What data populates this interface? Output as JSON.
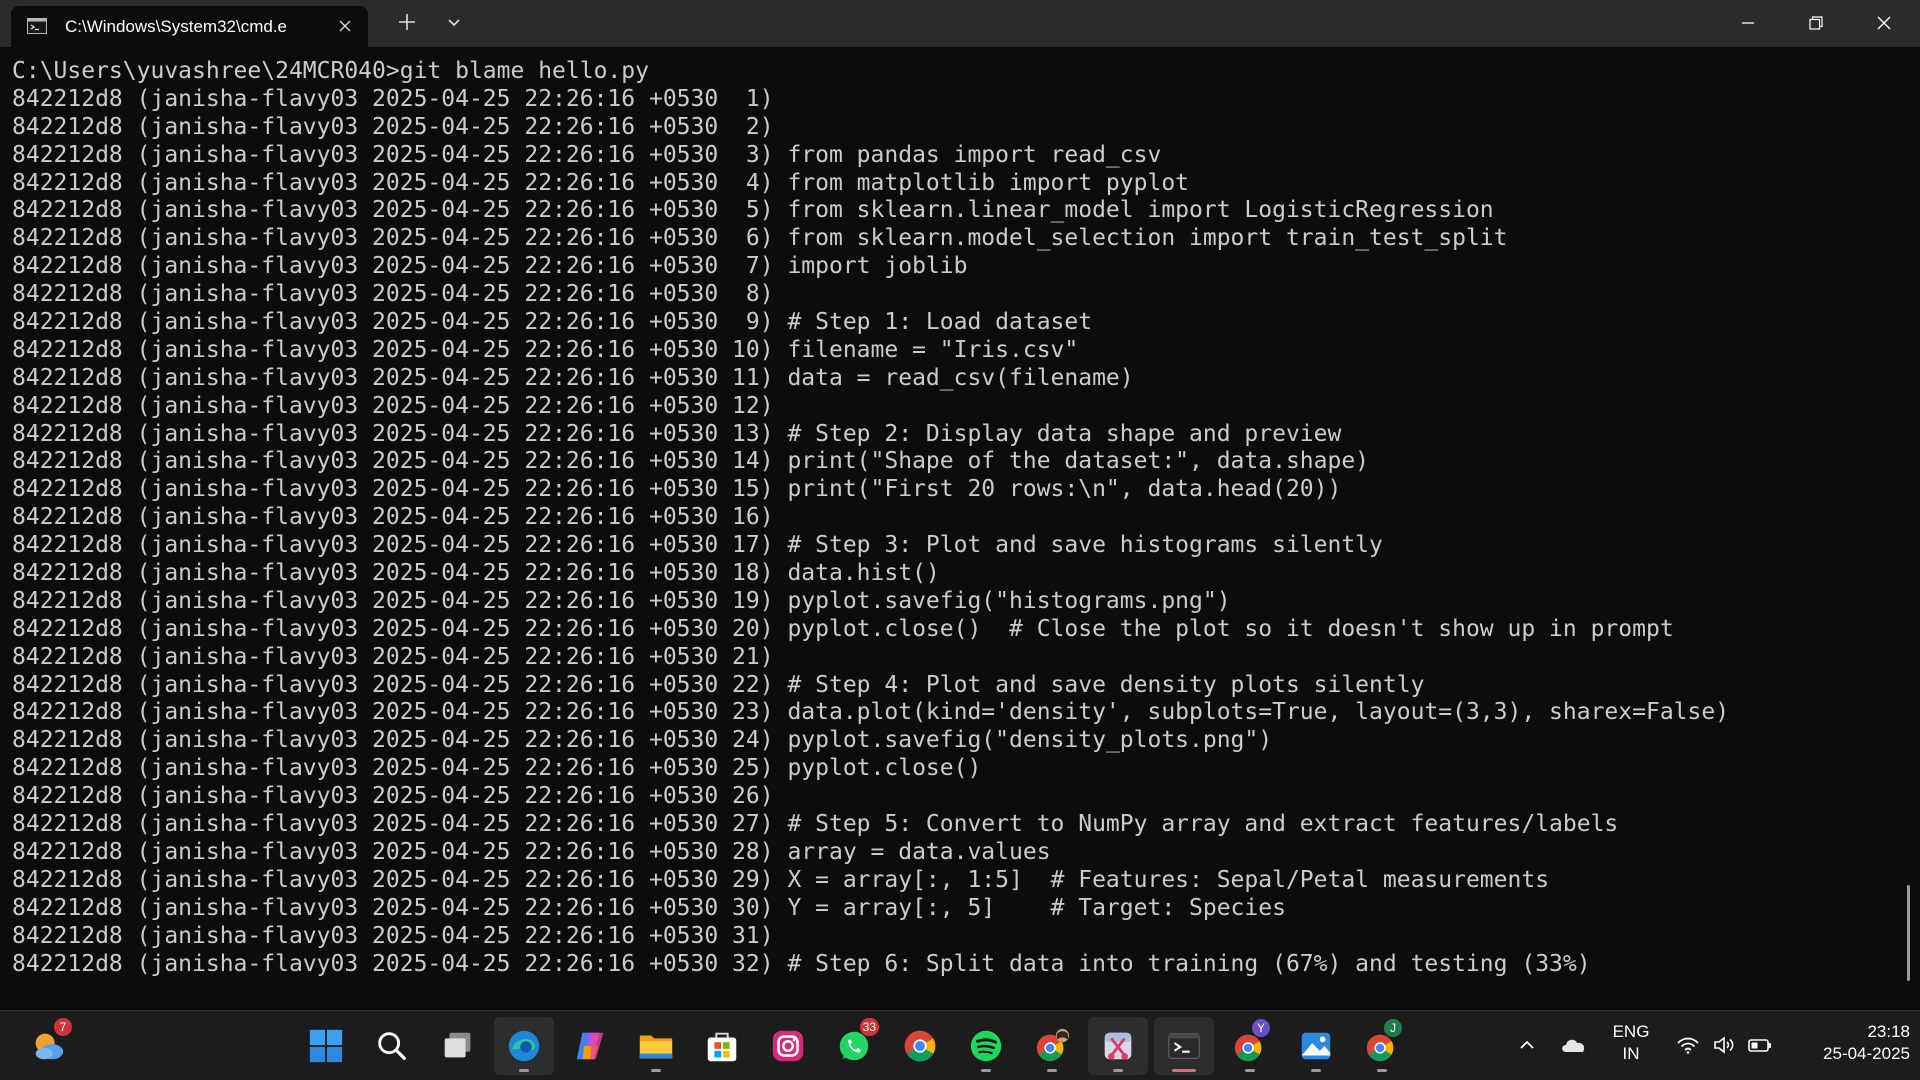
{
  "window": {
    "tab_title": "C:\\Windows\\System32\\cmd.e",
    "tab_icon": "cmd-icon",
    "accent": "#0c0c0c",
    "titlebar_color": "#2b2b2b"
  },
  "terminal": {
    "lines": [
      "C:\\Users\\yuvashree\\24MCR040>git blame hello.py",
      "842212d8 (janisha-flavy03 2025-04-25 22:26:16 +0530  1)",
      "842212d8 (janisha-flavy03 2025-04-25 22:26:16 +0530  2)",
      "842212d8 (janisha-flavy03 2025-04-25 22:26:16 +0530  3) from pandas import read_csv",
      "842212d8 (janisha-flavy03 2025-04-25 22:26:16 +0530  4) from matplotlib import pyplot",
      "842212d8 (janisha-flavy03 2025-04-25 22:26:16 +0530  5) from sklearn.linear_model import LogisticRegression",
      "842212d8 (janisha-flavy03 2025-04-25 22:26:16 +0530  6) from sklearn.model_selection import train_test_split",
      "842212d8 (janisha-flavy03 2025-04-25 22:26:16 +0530  7) import joblib",
      "842212d8 (janisha-flavy03 2025-04-25 22:26:16 +0530  8)",
      "842212d8 (janisha-flavy03 2025-04-25 22:26:16 +0530  9) # Step 1: Load dataset",
      "842212d8 (janisha-flavy03 2025-04-25 22:26:16 +0530 10) filename = \"Iris.csv\"",
      "842212d8 (janisha-flavy03 2025-04-25 22:26:16 +0530 11) data = read_csv(filename)",
      "842212d8 (janisha-flavy03 2025-04-25 22:26:16 +0530 12)",
      "842212d8 (janisha-flavy03 2025-04-25 22:26:16 +0530 13) # Step 2: Display data shape and preview",
      "842212d8 (janisha-flavy03 2025-04-25 22:26:16 +0530 14) print(\"Shape of the dataset:\", data.shape)",
      "842212d8 (janisha-flavy03 2025-04-25 22:26:16 +0530 15) print(\"First 20 rows:\\n\", data.head(20))",
      "842212d8 (janisha-flavy03 2025-04-25 22:26:16 +0530 16)",
      "842212d8 (janisha-flavy03 2025-04-25 22:26:16 +0530 17) # Step 3: Plot and save histograms silently",
      "842212d8 (janisha-flavy03 2025-04-25 22:26:16 +0530 18) data.hist()",
      "842212d8 (janisha-flavy03 2025-04-25 22:26:16 +0530 19) pyplot.savefig(\"histograms.png\")",
      "842212d8 (janisha-flavy03 2025-04-25 22:26:16 +0530 20) pyplot.close()  # Close the plot so it doesn't show up in prompt",
      "842212d8 (janisha-flavy03 2025-04-25 22:26:16 +0530 21)",
      "842212d8 (janisha-flavy03 2025-04-25 22:26:16 +0530 22) # Step 4: Plot and save density plots silently",
      "842212d8 (janisha-flavy03 2025-04-25 22:26:16 +0530 23) data.plot(kind='density', subplots=True, layout=(3,3), sharex=False)",
      "842212d8 (janisha-flavy03 2025-04-25 22:26:16 +0530 24) pyplot.savefig(\"density_plots.png\")",
      "842212d8 (janisha-flavy03 2025-04-25 22:26:16 +0530 25) pyplot.close()",
      "842212d8 (janisha-flavy03 2025-04-25 22:26:16 +0530 26)",
      "842212d8 (janisha-flavy03 2025-04-25 22:26:16 +0530 27) # Step 5: Convert to NumPy array and extract features/labels",
      "842212d8 (janisha-flavy03 2025-04-25 22:26:16 +0530 28) array = data.values",
      "842212d8 (janisha-flavy03 2025-04-25 22:26:16 +0530 29) X = array[:, 1:5]  # Features: Sepal/Petal measurements",
      "842212d8 (janisha-flavy03 2025-04-25 22:26:16 +0530 30) Y = array[:, 5]    # Target: Species",
      "842212d8 (janisha-flavy03 2025-04-25 22:26:16 +0530 31)",
      "842212d8 (janisha-flavy03 2025-04-25 22:26:16 +0530 32) # Step 6: Split data into training (67%) and testing (33%)"
    ],
    "text_color": "#cccccc",
    "background": "#0c0c0c"
  },
  "taskbar": {
    "weather_badge": "7",
    "whatsapp_badge": "33",
    "chrome_profile_y": "Y",
    "chrome_profile_j": "J",
    "apps": [
      "weather-widget-icon",
      "windows-start-icon",
      "search-icon",
      "task-view-icon",
      "edge-icon",
      "copilot-icon",
      "file-explorer-icon",
      "microsoft-store-icon",
      "instagram-icon",
      "whatsapp-icon",
      "chrome-icon",
      "spotify-icon",
      "chrome-profile-icon",
      "snipping-tool-icon",
      "terminal-icon",
      "chrome-profile-y-icon",
      "photos-icon",
      "chrome-profile-j-icon"
    ]
  },
  "tray": {
    "lang_line1": "ENG",
    "lang_line2": "IN",
    "time": "23:18",
    "date": "25-04-2025"
  }
}
